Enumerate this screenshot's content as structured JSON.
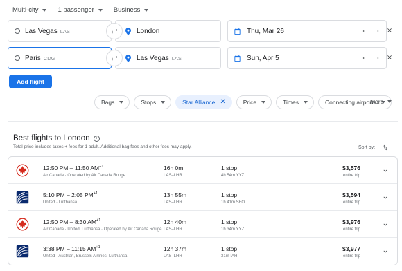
{
  "trip_options": {
    "trip_type": "Multi-city",
    "passengers": "1 passenger",
    "cabin_class": "Business"
  },
  "legs": [
    {
      "origin": "Las Vegas",
      "origin_code": "LAS",
      "destination": "London",
      "destination_code": "",
      "date": "Thu, Mar 26"
    },
    {
      "origin": "Paris",
      "origin_code": "CDG",
      "destination": "Las Vegas",
      "destination_code": "LAS",
      "date": "Sun, Apr 5"
    }
  ],
  "add_flight_label": "Add flight",
  "filters": [
    {
      "label": "Bags",
      "active": false
    },
    {
      "label": "Stops",
      "active": false
    },
    {
      "label": "Star Alliance",
      "active": true
    },
    {
      "label": "Price",
      "active": false
    },
    {
      "label": "Times",
      "active": false
    },
    {
      "label": "Connecting airports",
      "active": false
    }
  ],
  "more_label": "More",
  "results_header": {
    "title": "Best flights to London",
    "subtitle_prefix": "Total price includes taxes + fees for 1 adult. ",
    "subtitle_link": "Additional bag fees",
    "subtitle_suffix": " and other fees may apply.",
    "sort_label": "Sort by:"
  },
  "flights": [
    {
      "logo": "air-canada-logo",
      "depart": "12:50 PM",
      "arrive": "11:50 AM",
      "day_offset": "+1",
      "airline": "Air Canada · Operated by Air Canada Rouge",
      "duration": "16h 0m",
      "route": "LAS–LHR",
      "stops": "1 stop",
      "layover": "4h 54m YYZ",
      "price": "$3,576",
      "price_note": "entire trip"
    },
    {
      "logo": "united-logo",
      "depart": "5:10 PM",
      "arrive": "2:05 PM",
      "day_offset": "+1",
      "airline": "United · Lufthansa",
      "duration": "13h 55m",
      "route": "LAS–LHR",
      "stops": "1 stop",
      "layover": "1h 41m SFO",
      "price": "$3,594",
      "price_note": "entire trip"
    },
    {
      "logo": "air-canada-logo",
      "depart": "12:50 PM",
      "arrive": "8:30 AM",
      "day_offset": "+1",
      "airline": "Air Canada · United, Lufthansa · Operated by Air Canada Rouge",
      "duration": "12h 40m",
      "route": "LAS–LHR",
      "stops": "1 stop",
      "layover": "1h 34m YYZ",
      "price": "$3,976",
      "price_note": "entire trip"
    },
    {
      "logo": "united-logo",
      "depart": "3:38 PM",
      "arrive": "11:15 AM",
      "day_offset": "+1",
      "airline": "United · Austrian, Brussels Airlines, Lufthansa",
      "duration": "12h 37m",
      "route": "LAS–LHR",
      "stops": "1 stop",
      "layover": "31m IAH",
      "price": "$3,977",
      "price_note": "entire trip"
    }
  ],
  "colors": {
    "accent": "#1a73e8",
    "active_chip_bg": "#e8f0fe",
    "air_canada_red": "#d52b1e",
    "united_blue": "#0a2a6e"
  }
}
